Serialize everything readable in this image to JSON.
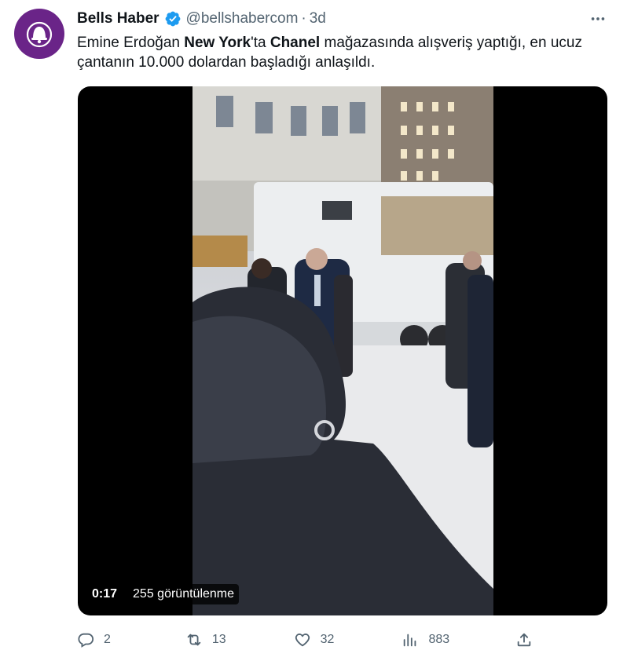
{
  "author": {
    "name": "Bells Haber",
    "handle": "@bellshabercom",
    "separator": "·",
    "time": "3d"
  },
  "tweet": {
    "text_part1": "Emine Erdoğan ",
    "text_bold1": "New York",
    "text_part2": "'ta ",
    "text_bold2": "Chanel",
    "text_part3": " mağazasında alışveriş yaptığı, en ucuz çantanın 10.000 dolardan başladığı anlaşıldı."
  },
  "media": {
    "duration": "0:17",
    "views": "255 görüntülenme"
  },
  "actions": {
    "replies": "2",
    "retweets": "13",
    "likes": "32",
    "views": "883"
  },
  "colors": {
    "avatar_bg": "#6a2488",
    "verified": "#1d9bf0",
    "muted": "#536471"
  },
  "icons": [
    "bell-logo-icon",
    "verified-badge-icon",
    "more-icon",
    "reply-icon",
    "retweet-icon",
    "like-icon",
    "views-icon",
    "share-icon"
  ]
}
